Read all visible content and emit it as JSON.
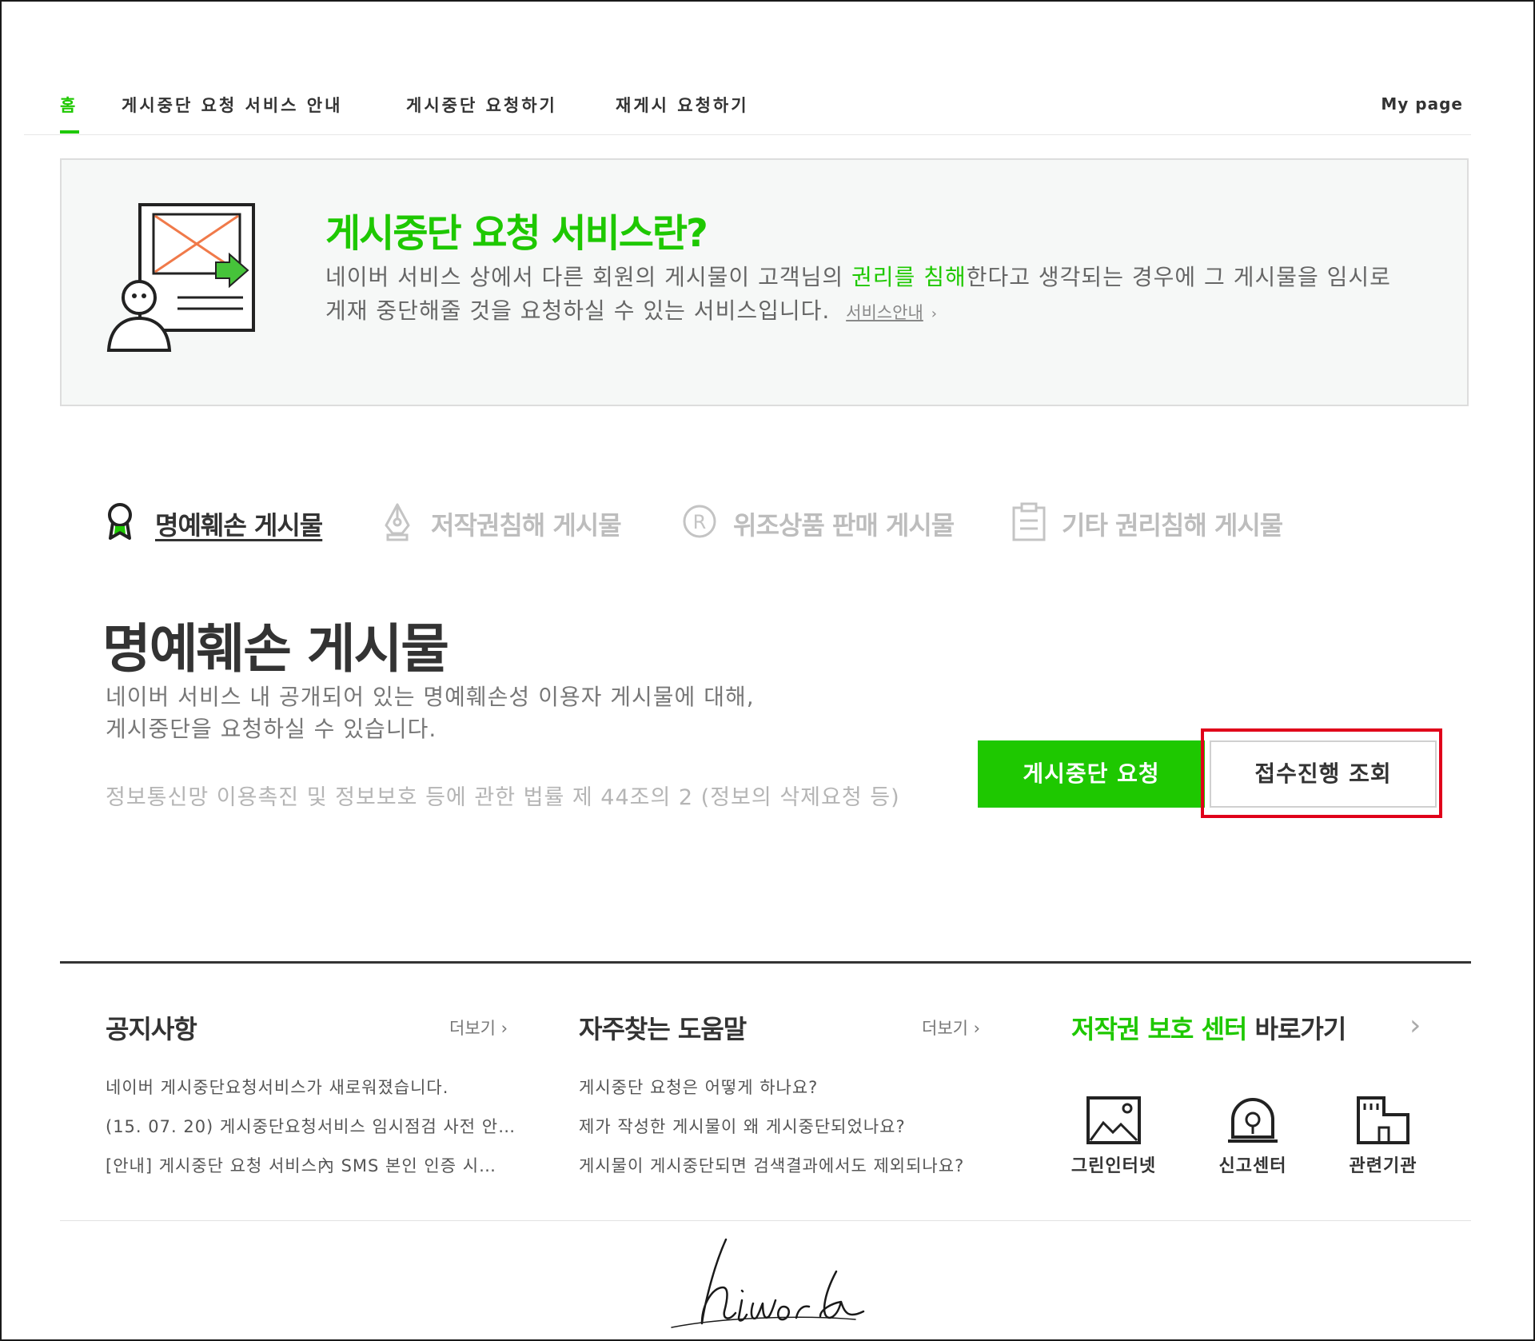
{
  "nav": {
    "items": [
      "홈",
      "게시중단 요청 서비스 안내",
      "게시중단 요청하기",
      "재게시 요청하기"
    ],
    "mypage": "My page"
  },
  "intro": {
    "title": "게시중단 요청 서비스란?",
    "desc_part1": "네이버 서비스 상에서 다른 회원의 게시물이 고객님의 ",
    "desc_highlight": "권리를 침해",
    "desc_part2": "한다고 생각되는 경우에 그 게시물을 임시로",
    "desc_line2": "게재 중단해줄 것을 요청하실 수 있는 서비스입니다.",
    "link": "서비스안내",
    "link_arrow": "›"
  },
  "categories": [
    {
      "label": "명예훼손 게시물",
      "icon": "award-ribbon-icon",
      "active": true
    },
    {
      "label": "저작권침해 게시물",
      "icon": "pen-nib-icon",
      "active": false
    },
    {
      "label": "위조상품 판매 게시물",
      "icon": "registered-mark-icon",
      "active": false
    },
    {
      "label": "기타 권리침해 게시물",
      "icon": "clipboard-icon",
      "active": false
    }
  ],
  "section": {
    "title": "명예훼손 게시물",
    "desc_line1": "네이버 서비스 내 공개되어 있는 명예훼손성 이용자 게시물에 대해,",
    "desc_line2": "게시중단을 요청하실 수 있습니다.",
    "law": "정보통신망 이용촉진 및 정보보호 등에 관한 법률 제 44조의 2 (정보의 삭제요청 등)",
    "btn_request": "게시중단 요청",
    "btn_status": "접수진행 조회"
  },
  "notice": {
    "title": "공지사항",
    "more": "더보기 ›",
    "items": [
      "네이버 게시중단요청서비스가 새로워졌습니다.",
      "(15. 07. 20) 게시중단요청서비스 임시점검 사전 안…",
      "[안내] 게시중단 요청 서비스內 SMS 본인 인증 시…"
    ]
  },
  "faq": {
    "title": "자주찾는 도움말",
    "more": "더보기 ›",
    "items": [
      "게시중단 요청은 어떻게 하나요?",
      "제가 작성한 게시물이 왜 게시중단되었나요?",
      "게시물이 게시중단되면 검색결과에서도 제외되나요?"
    ]
  },
  "copyright_center": {
    "title_green": "저작권 보호 센터",
    "title_rest": " 바로가기",
    "arrow": "›",
    "shortcuts": [
      {
        "label": "그린인터넷",
        "icon": "image-icon"
      },
      {
        "label": "신고센터",
        "icon": "report-siren-icon"
      },
      {
        "label": "관련기관",
        "icon": "building-icon"
      }
    ]
  },
  "signature": "hiword",
  "colors": {
    "brand_green": "#1ec800",
    "highlight_red": "#e0001a"
  }
}
